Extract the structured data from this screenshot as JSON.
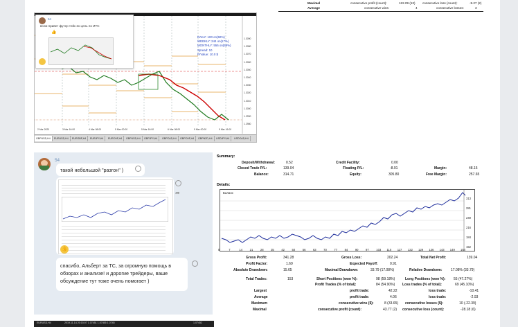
{
  "top_right_report": {
    "row1": {
      "label": "Maximal",
      "c1": "consecutive profit (count):",
      "v1": "122.09 (13)",
      "c2": "consecutive loss (count):",
      "v2": "-9.27 (2)"
    },
    "row2": {
      "label": "Average",
      "c1": "consecutive wins:",
      "v1": "4",
      "c2": "consecutive losses:",
      "v2": "3"
    }
  },
  "chart_screenshot": {
    "info_lines": [
      "DAILY: 100 on(50%)",
      "WEEKLY: 244 on(17%)",
      "MONTHLY: 555 on(59%)",
      "Spread: 10",
      "PrValue: 10.0 $"
    ],
    "price_axis": [
      "1.3090",
      "1.3080",
      "1.3070",
      "1.3060",
      "1.3050",
      "1.3040",
      "1.3030",
      "1.3020",
      "1.3010",
      "1.3000",
      "1.2990",
      "1.2980"
    ],
    "time_axis": [
      "2 Mar 2020",
      "3 Mar 16:00",
      "4 Mar 08:00",
      "5 Mar 00:00",
      "5 Mar 16:00",
      "6 Mar 08:00",
      "9 Mar 00:00",
      "9 Mar 16:00"
    ],
    "tabs": [
      "GBPUSD,H4",
      "EURUSD,H4",
      "EURGBP,H4",
      "EURJPY,H4",
      "EURCHF,H4",
      "GBPUSD,H4",
      "GBPJPY,H4",
      "GBPCAD,H4",
      "GBPCHF,H4",
      "GBPNZD,H4",
      "USDJPY,H4",
      "USDCAD,H4"
    ],
    "popup": {
      "name": "54",
      "text": "всем привет футер тейк 2х цель по ИТС",
      "emoji": "👍"
    }
  },
  "chat": {
    "name": "54",
    "msg1": "такой небольшой \"разгон\" )",
    "msg2_lines": [
      "спасибо, Альберт за ТС, за огромную помощь в",
      "обзорах и анализе! и дорогие трейдеры, ваше",
      "обсуждение тут тоже очень помогает )"
    ],
    "thumb_emoji": "👍"
  },
  "report": {
    "summary_title": "Summary:",
    "details_title": "Details:",
    "graph_legend": "Баланс",
    "summary_rows": [
      {
        "l1": "Deposit/Withdrawal:",
        "v1": "0.52",
        "l2": "Credit Facility:",
        "v2": "0.00",
        "l3": "",
        "v3": ""
      },
      {
        "l1": "Closed Trade P/L:",
        "v1": "139.04",
        "l2": "Floating P/L:",
        "v2": "-8.91",
        "l3": "Margin:",
        "v3": "48.15"
      },
      {
        "l1": "Balance:",
        "v1": "314.71",
        "l2": "Equity:",
        "v2": "305.80",
        "l3": "Free Margin:",
        "v3": "257.65"
      }
    ],
    "x_ticks": [
      "0",
      "7",
      "14",
      "21",
      "28",
      "35",
      "42",
      "50",
      "56",
      "63",
      "70",
      "77",
      "84",
      "90",
      "97",
      "103",
      "110",
      "117",
      "122",
      "129",
      "136",
      "143",
      "149",
      "154"
    ],
    "y_ticks": [
      "313",
      "281",
      "249",
      "216",
      "184",
      "152"
    ],
    "stat_rows": [
      {
        "l1": "Gross Profit:",
        "v1": "341.28",
        "l2": "Gross Loss:",
        "v2": "202.24",
        "l3": "Total Net Profit:",
        "v3": "139.04"
      },
      {
        "l1": "Profit Factor:",
        "v1": "1.69",
        "l2": "Expected Payoff:",
        "v2": "0.91",
        "l3": "",
        "v3": ""
      },
      {
        "l1": "Absolute Drawdown:",
        "v1": "15.65",
        "l2": "Maximal Drawdown:",
        "v2": "33.79 (17.08%)",
        "l3": "Relative Drawdown:",
        "v3": "17.08% (33.79)"
      }
    ],
    "trade_rows": [
      {
        "l0": "Total Trades:",
        "v0": "153",
        "l1": "Short Positions (won %):",
        "v1": "98 (59.18%)",
        "l2": "Long Positions (won %):",
        "v2": "55 (47.27%)"
      },
      {
        "l0": "",
        "v0": "",
        "l1": "Profit Trades (% of total):",
        "v1": "84 (54.90%)",
        "l2": "Loss trades (% of total):",
        "v2": "69 (45.10%)"
      },
      {
        "l0": "Largest",
        "v0": "",
        "l1": "profit trade:",
        "v1": "42.22",
        "l2": "loss trade:",
        "v2": "-10.41"
      },
      {
        "l0": "Average",
        "v0": "",
        "l1": "profit trade:",
        "v1": "4.06",
        "l2": "loss trade:",
        "v2": "-2.93"
      },
      {
        "l0": "Maximum",
        "v0": "",
        "l1": "consecutive wins ($):",
        "v1": "8 (33.65)",
        "l2": "consecutive losses ($):",
        "v2": "10 (-22.39)"
      },
      {
        "l0": "Maximal",
        "v0": "",
        "l1": "consecutive profit (count):",
        "v1": "43.77 (2)",
        "l2": "consecutive loss (count):",
        "v2": "-28.18 (6)"
      }
    ]
  },
  "bottom_strip": {
    "left": "EURUSD,H4",
    "mid": "2019.11.14 20:15:07  1.07451  1.07455  1.0745",
    "right": "1.07452"
  }
}
